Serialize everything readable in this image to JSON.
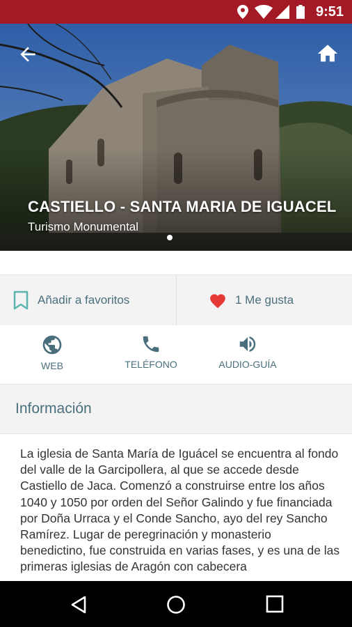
{
  "status_bar": {
    "time": "9:51",
    "icons": [
      "location-icon",
      "wifi-icon",
      "signal-icon",
      "battery-icon"
    ],
    "color": "#a31a26"
  },
  "hero": {
    "title": "CASTIELLO - SANTA MARIA DE IGUACEL",
    "subtitle": "Turismo Monumental",
    "back_icon": "arrow-back-icon",
    "home_icon": "home-icon"
  },
  "actions": {
    "favorite_label": "Añadir a favoritos",
    "favorite_icon": "bookmark-icon",
    "like_label": "1 Me gusta",
    "like_icon": "heart-icon",
    "like_color": "#e53935"
  },
  "contact": {
    "items": [
      {
        "label": "WEB",
        "icon": "globe-icon"
      },
      {
        "label": "TELÉFONO",
        "icon": "phone-icon"
      },
      {
        "label": "AUDIO-GUÍA",
        "icon": "volume-icon"
      }
    ]
  },
  "info": {
    "header": "Información",
    "description": "La iglesia de Santa María de Iguácel se encuentra al fondo del valle de la Garcipollera, al que se accede desde Castiello de Jaca. Comenzó a construirse entre los años 1040 y 1050  por orden del Señor Galindo y fue financiada por Doña Urraca y el Conde Sancho, ayo del rey Sancho Ramírez. Lugar de peregrinación y monasterio benedictino, fue construida en varias fases, y es una de las primeras iglesias de Aragón con cabecera"
  },
  "nav": {
    "icons": [
      "back-nav-icon",
      "home-nav-icon",
      "recents-nav-icon"
    ]
  },
  "colors": {
    "accent": "#4a6f7c",
    "section_bg": "#f3f3f3"
  }
}
